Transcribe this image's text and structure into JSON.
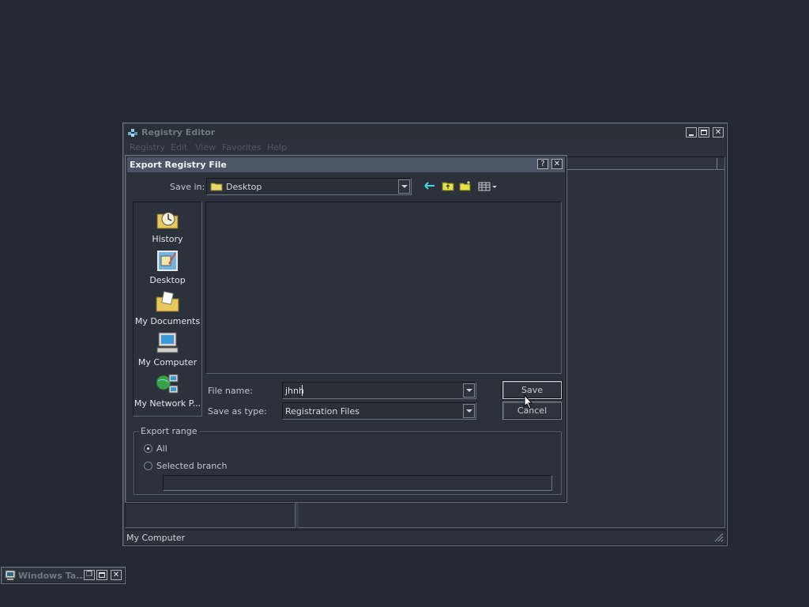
{
  "registry_editor": {
    "title": "Registry Editor",
    "menu": [
      "Registry",
      "Edit",
      "View",
      "Favorites",
      "Help"
    ],
    "status_text": "My Computer"
  },
  "dialog": {
    "title": "Export Registry File",
    "help_glyph": "?",
    "close_glyph": "✕",
    "save_in_label": "Save in:",
    "save_in_value": "Desktop",
    "places": [
      {
        "label": "History",
        "icon": "history-icon"
      },
      {
        "label": "Desktop",
        "icon": "desktop-icon"
      },
      {
        "label": "My Documents",
        "icon": "my-documents-icon"
      },
      {
        "label": "My Computer",
        "icon": "my-computer-icon"
      },
      {
        "label": "My Network P...",
        "icon": "my-network-places-icon"
      }
    ],
    "file_name_label": "File name:",
    "file_name_value": "jhnh",
    "save_type_label": "Save as type:",
    "save_type_value": "Registration Files",
    "save_button": "Save",
    "cancel_button": "Cancel",
    "export_range": {
      "legend": "Export range",
      "option_all": "All",
      "option_branch": "Selected branch",
      "selected": "All",
      "branch_value": ""
    }
  },
  "taskbar_window": {
    "title": "Windows Ta..."
  },
  "colors": {
    "desktop": "#242a33",
    "dialog_title_bar": "#4b5563",
    "window_frame": "#2c323b"
  }
}
